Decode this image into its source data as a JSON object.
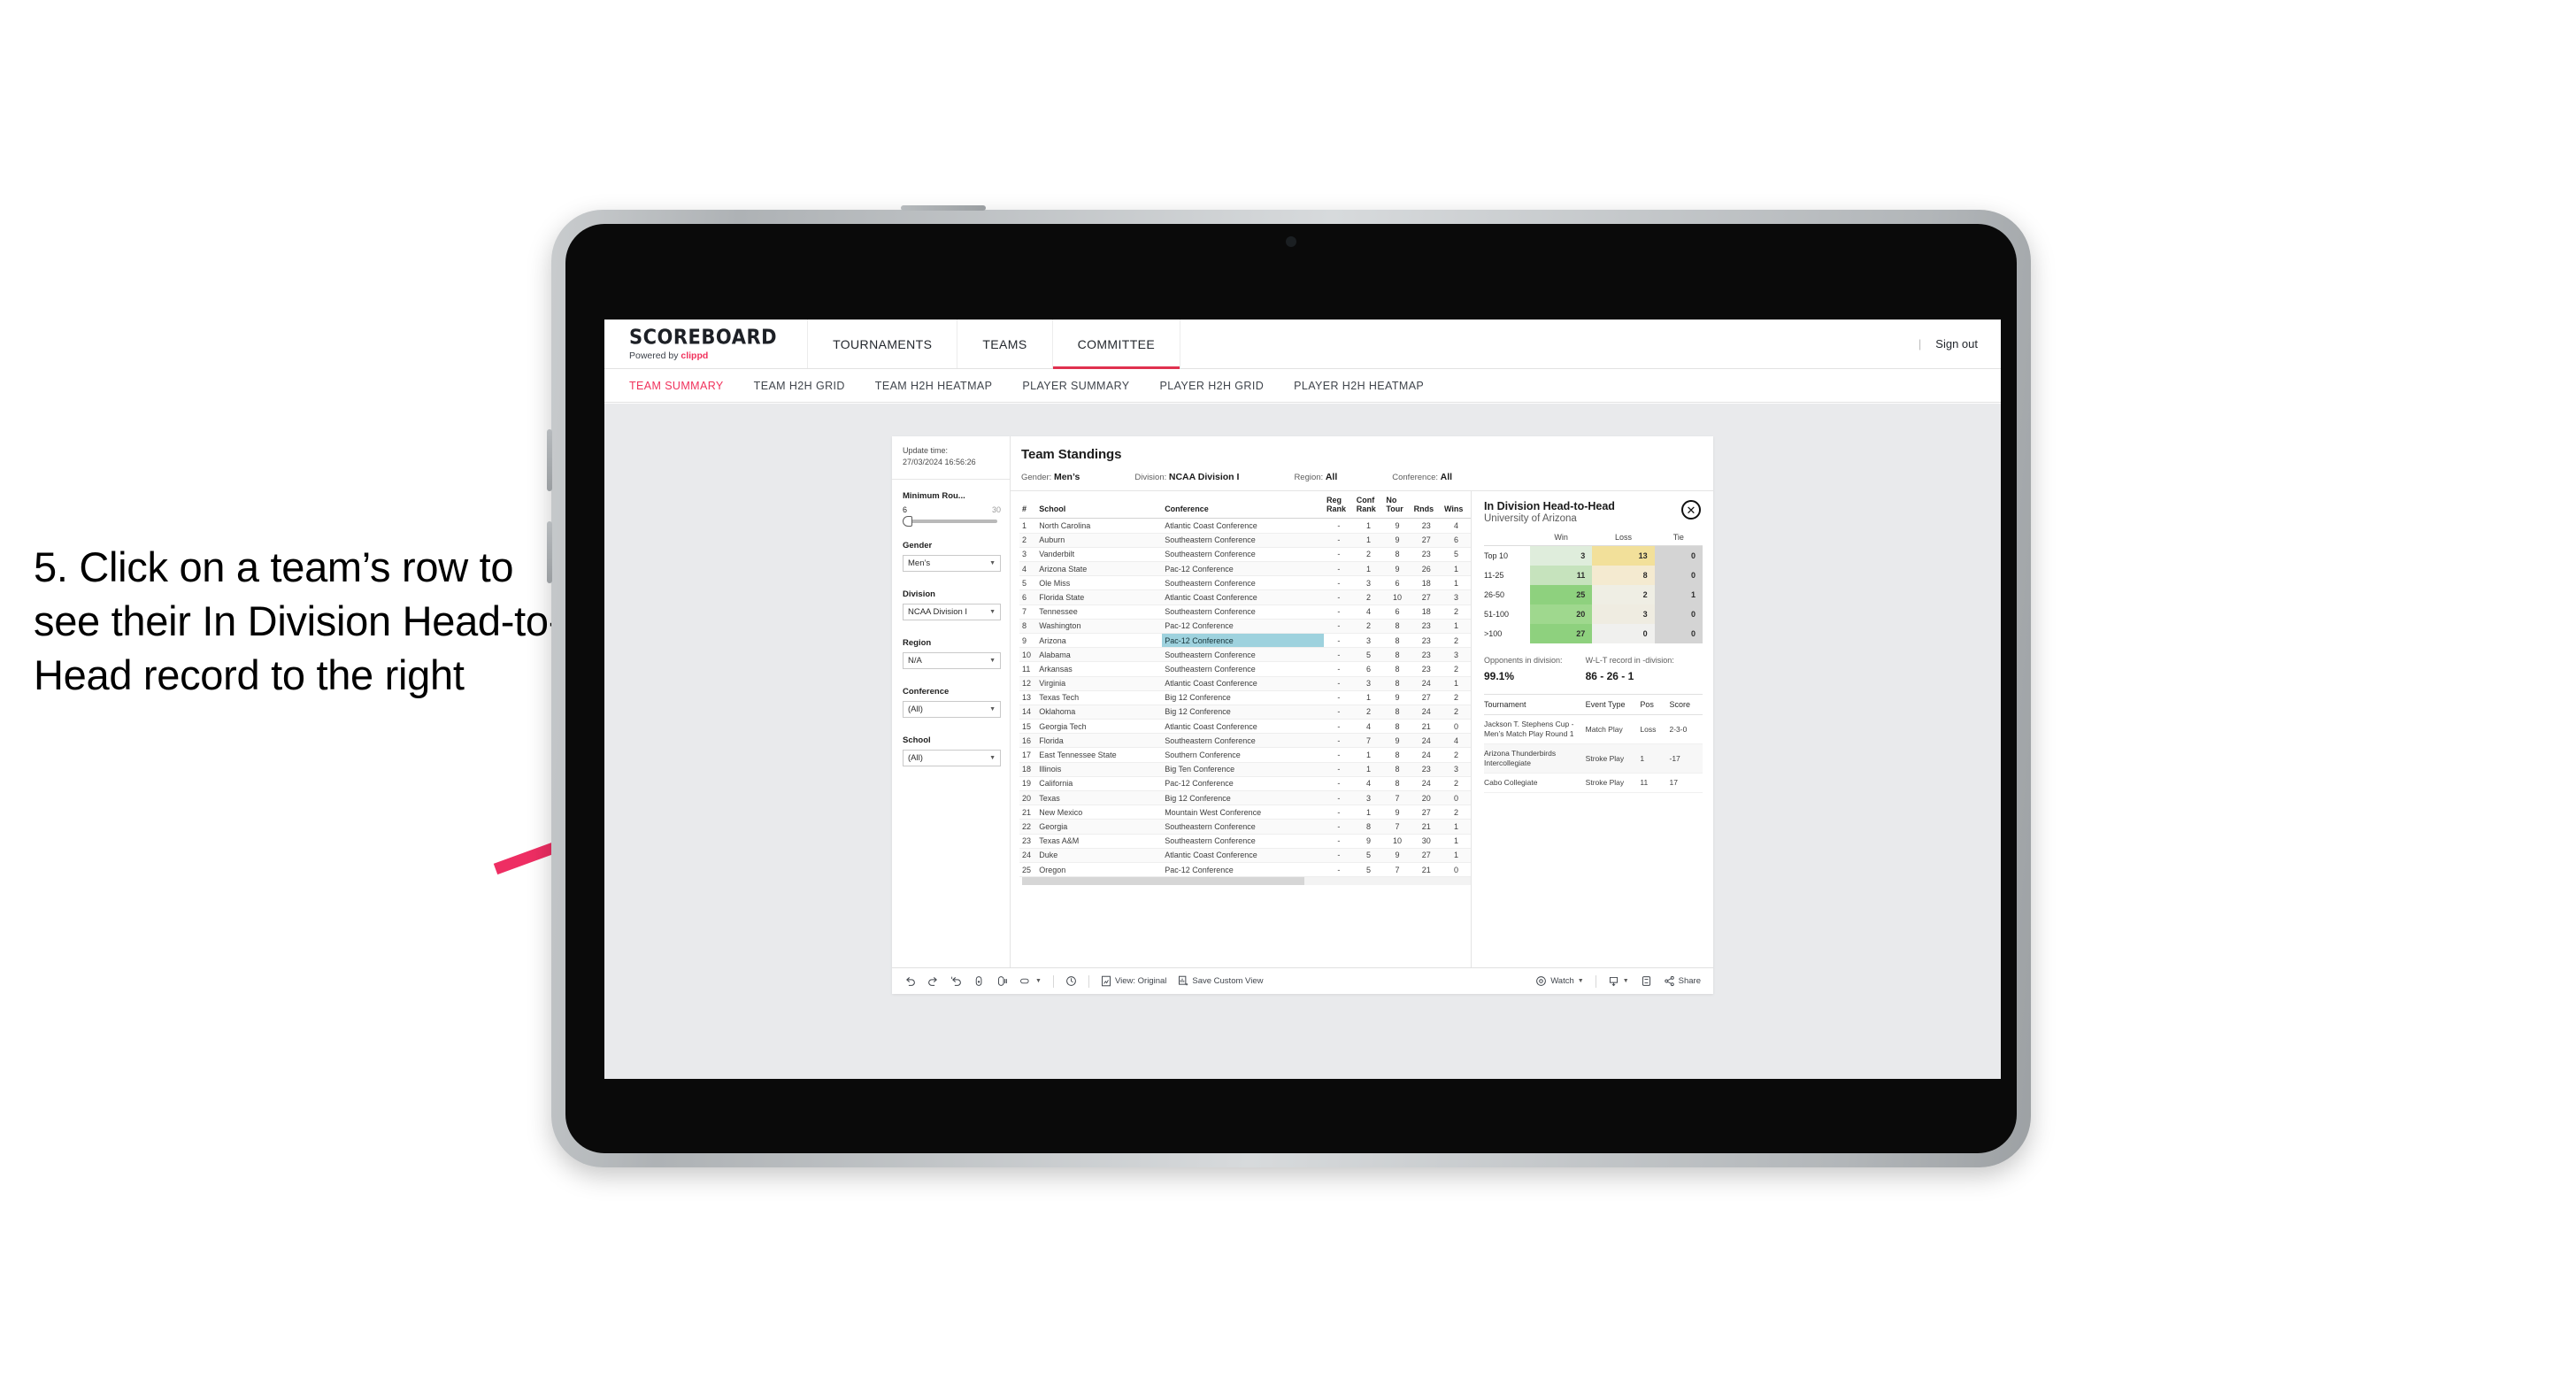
{
  "instruction": "5. Click on a team’s row to see their In Division Head-to-Head record to the right",
  "colors": {
    "accent": "#f0325c",
    "arrow": "#ee2e63",
    "selected_cell": "#9ed2de",
    "workspace_bg": "#e9eaec"
  },
  "topnav": {
    "brand_main": "SCOREBOARD",
    "brand_sub_prefix": "Powered by ",
    "brand_sub_name": "clippd",
    "items": [
      {
        "label": "TOURNAMENTS",
        "active": false
      },
      {
        "label": "TEAMS",
        "active": false
      },
      {
        "label": "COMMITTEE",
        "active": true
      }
    ],
    "divider": "|",
    "signout": "Sign out"
  },
  "subnav": {
    "items": [
      {
        "label": "TEAM SUMMARY",
        "active": true
      },
      {
        "label": "TEAM H2H GRID",
        "active": false
      },
      {
        "label": "TEAM H2H HEATMAP",
        "active": false
      },
      {
        "label": "PLAYER SUMMARY",
        "active": false
      },
      {
        "label": "PLAYER H2H GRID",
        "active": false
      },
      {
        "label": "PLAYER H2H HEATMAP",
        "active": false
      }
    ]
  },
  "filters": {
    "update_label": "Update time:",
    "update_value": "27/03/2024 16:56:26",
    "min_rounds": {
      "label": "Minimum Rou...",
      "low": "6",
      "high": "30"
    },
    "gender": {
      "label": "Gender",
      "value": "Men’s"
    },
    "division": {
      "label": "Division",
      "value": "NCAA Division I"
    },
    "region": {
      "label": "Region",
      "value": "N/A"
    },
    "conference": {
      "label": "Conference",
      "value": "(All)"
    },
    "school": {
      "label": "School",
      "value": "(All)"
    }
  },
  "standings": {
    "title": "Team Standings",
    "summary": [
      {
        "label": "Gender:",
        "value": "Men’s"
      },
      {
        "label": "Division:",
        "value": "NCAA Division I"
      },
      {
        "label": "Region:",
        "value": "All"
      },
      {
        "label": "Conference:",
        "value": "All"
      }
    ],
    "columns": [
      "#",
      "School",
      "Conference",
      "Reg Rank",
      "Conf Rank",
      "No Tour",
      "Rnds",
      "Wins"
    ],
    "columns_wrapped": [
      {
        "l1": "#",
        "l2": ""
      },
      {
        "l1": "School",
        "l2": ""
      },
      {
        "l1": "Conference",
        "l2": ""
      },
      {
        "l1": "Reg",
        "l2": "Rank"
      },
      {
        "l1": "Conf",
        "l2": "Rank"
      },
      {
        "l1": "No",
        "l2": "Tour"
      },
      {
        "l1": "Rnds",
        "l2": ""
      },
      {
        "l1": "Wins",
        "l2": ""
      }
    ],
    "selected_row_index": 8,
    "rows": [
      {
        "n": "1",
        "school": "North Carolina",
        "conf": "Atlantic Coast Conference",
        "reg": "-",
        "cr": "1",
        "nt": "9",
        "rn": "23",
        "wn": "4"
      },
      {
        "n": "2",
        "school": "Auburn",
        "conf": "Southeastern Conference",
        "reg": "-",
        "cr": "1",
        "nt": "9",
        "rn": "27",
        "wn": "6"
      },
      {
        "n": "3",
        "school": "Vanderbilt",
        "conf": "Southeastern Conference",
        "reg": "-",
        "cr": "2",
        "nt": "8",
        "rn": "23",
        "wn": "5"
      },
      {
        "n": "4",
        "school": "Arizona State",
        "conf": "Pac-12 Conference",
        "reg": "-",
        "cr": "1",
        "nt": "9",
        "rn": "26",
        "wn": "1"
      },
      {
        "n": "5",
        "school": "Ole Miss",
        "conf": "Southeastern Conference",
        "reg": "-",
        "cr": "3",
        "nt": "6",
        "rn": "18",
        "wn": "1"
      },
      {
        "n": "6",
        "school": "Florida State",
        "conf": "Atlantic Coast Conference",
        "reg": "-",
        "cr": "2",
        "nt": "10",
        "rn": "27",
        "wn": "3"
      },
      {
        "n": "7",
        "school": "Tennessee",
        "conf": "Southeastern Conference",
        "reg": "-",
        "cr": "4",
        "nt": "6",
        "rn": "18",
        "wn": "2"
      },
      {
        "n": "8",
        "school": "Washington",
        "conf": "Pac-12 Conference",
        "reg": "-",
        "cr": "2",
        "nt": "8",
        "rn": "23",
        "wn": "1"
      },
      {
        "n": "9",
        "school": "Arizona",
        "conf": "Pac-12 Conference",
        "reg": "-",
        "cr": "3",
        "nt": "8",
        "rn": "23",
        "wn": "2"
      },
      {
        "n": "10",
        "school": "Alabama",
        "conf": "Southeastern Conference",
        "reg": "-",
        "cr": "5",
        "nt": "8",
        "rn": "23",
        "wn": "3"
      },
      {
        "n": "11",
        "school": "Arkansas",
        "conf": "Southeastern Conference",
        "reg": "-",
        "cr": "6",
        "nt": "8",
        "rn": "23",
        "wn": "2"
      },
      {
        "n": "12",
        "school": "Virginia",
        "conf": "Atlantic Coast Conference",
        "reg": "-",
        "cr": "3",
        "nt": "8",
        "rn": "24",
        "wn": "1"
      },
      {
        "n": "13",
        "school": "Texas Tech",
        "conf": "Big 12 Conference",
        "reg": "-",
        "cr": "1",
        "nt": "9",
        "rn": "27",
        "wn": "2"
      },
      {
        "n": "14",
        "school": "Oklahoma",
        "conf": "Big 12 Conference",
        "reg": "-",
        "cr": "2",
        "nt": "8",
        "rn": "24",
        "wn": "2"
      },
      {
        "n": "15",
        "school": "Georgia Tech",
        "conf": "Atlantic Coast Conference",
        "reg": "-",
        "cr": "4",
        "nt": "8",
        "rn": "21",
        "wn": "0"
      },
      {
        "n": "16",
        "school": "Florida",
        "conf": "Southeastern Conference",
        "reg": "-",
        "cr": "7",
        "nt": "9",
        "rn": "24",
        "wn": "4"
      },
      {
        "n": "17",
        "school": "East Tennessee State",
        "conf": "Southern Conference",
        "reg": "-",
        "cr": "1",
        "nt": "8",
        "rn": "24",
        "wn": "2"
      },
      {
        "n": "18",
        "school": "Illinois",
        "conf": "Big Ten Conference",
        "reg": "-",
        "cr": "1",
        "nt": "8",
        "rn": "23",
        "wn": "3"
      },
      {
        "n": "19",
        "school": "California",
        "conf": "Pac-12 Conference",
        "reg": "-",
        "cr": "4",
        "nt": "8",
        "rn": "24",
        "wn": "2"
      },
      {
        "n": "20",
        "school": "Texas",
        "conf": "Big 12 Conference",
        "reg": "-",
        "cr": "3",
        "nt": "7",
        "rn": "20",
        "wn": "0"
      },
      {
        "n": "21",
        "school": "New Mexico",
        "conf": "Mountain West Conference",
        "reg": "-",
        "cr": "1",
        "nt": "9",
        "rn": "27",
        "wn": "2"
      },
      {
        "n": "22",
        "school": "Georgia",
        "conf": "Southeastern Conference",
        "reg": "-",
        "cr": "8",
        "nt": "7",
        "rn": "21",
        "wn": "1"
      },
      {
        "n": "23",
        "school": "Texas A&M",
        "conf": "Southeastern Conference",
        "reg": "-",
        "cr": "9",
        "nt": "10",
        "rn": "30",
        "wn": "1"
      },
      {
        "n": "24",
        "school": "Duke",
        "conf": "Atlantic Coast Conference",
        "reg": "-",
        "cr": "5",
        "nt": "9",
        "rn": "27",
        "wn": "1"
      },
      {
        "n": "25",
        "school": "Oregon",
        "conf": "Pac-12 Conference",
        "reg": "-",
        "cr": "5",
        "nt": "7",
        "rn": "21",
        "wn": "0"
      }
    ]
  },
  "h2h": {
    "title": "In Division Head-to-Head",
    "subtitle": "University of Arizona",
    "close_icon": "✕",
    "columns": [
      "",
      "Win",
      "Loss",
      "Tie"
    ],
    "rows": [
      {
        "bucket": "Top 10",
        "win": "3",
        "loss": "13",
        "tie": "0",
        "win_bg": "#dfeddc",
        "loss_bg": "#f2e09a",
        "tie_bg": "#d4d4d4"
      },
      {
        "bucket": "11-25",
        "win": "11",
        "loss": "8",
        "tie": "0",
        "win_bg": "#c6e3bd",
        "loss_bg": "#f4ead0",
        "tie_bg": "#d4d4d4"
      },
      {
        "bucket": "26-50",
        "win": "25",
        "loss": "2",
        "tie": "1",
        "win_bg": "#8ed17e",
        "loss_bg": "#efeee4",
        "tie_bg": "#d4d4d4"
      },
      {
        "bucket": "51-100",
        "win": "20",
        "loss": "3",
        "tie": "0",
        "win_bg": "#9fd88e",
        "loss_bg": "#efece1",
        "tie_bg": "#d4d4d4"
      },
      {
        "bucket": ">100",
        "win": "27",
        "loss": "0",
        "tie": "0",
        "win_bg": "#8ed17e",
        "loss_bg": "#f0f0ee",
        "tie_bg": "#d4d4d4"
      }
    ],
    "stats": [
      {
        "label": "Opponents in division:",
        "value": "99.1%"
      },
      {
        "label": "W-L-T record in -division:",
        "value": "86 - 26 - 1"
      }
    ],
    "tournaments": {
      "columns": [
        "Tournament",
        "Event Type",
        "Pos",
        "Score"
      ],
      "rows": [
        {
          "name": "Jackson T. Stephens Cup - Men’s Match Play Round 1",
          "type": "Match Play",
          "pos": "Loss",
          "score": "2-3-0"
        },
        {
          "name": "Arizona Thunderbirds Intercollegiate",
          "type": "Stroke Play",
          "pos": "1",
          "score": "-17"
        },
        {
          "name": "Cabo Collegiate",
          "type": "Stroke Play",
          "pos": "11",
          "score": "17"
        }
      ]
    }
  },
  "toolbar": {
    "undo": "undo-icon",
    "redo": "redo-icon",
    "revert": "revert-icon",
    "refresh": "refresh-data-icon",
    "pause": "pause-updates-icon",
    "view_label": "View: Original",
    "save_label": "Save Custom View",
    "watch_label": "Watch",
    "share_label": "Share"
  }
}
